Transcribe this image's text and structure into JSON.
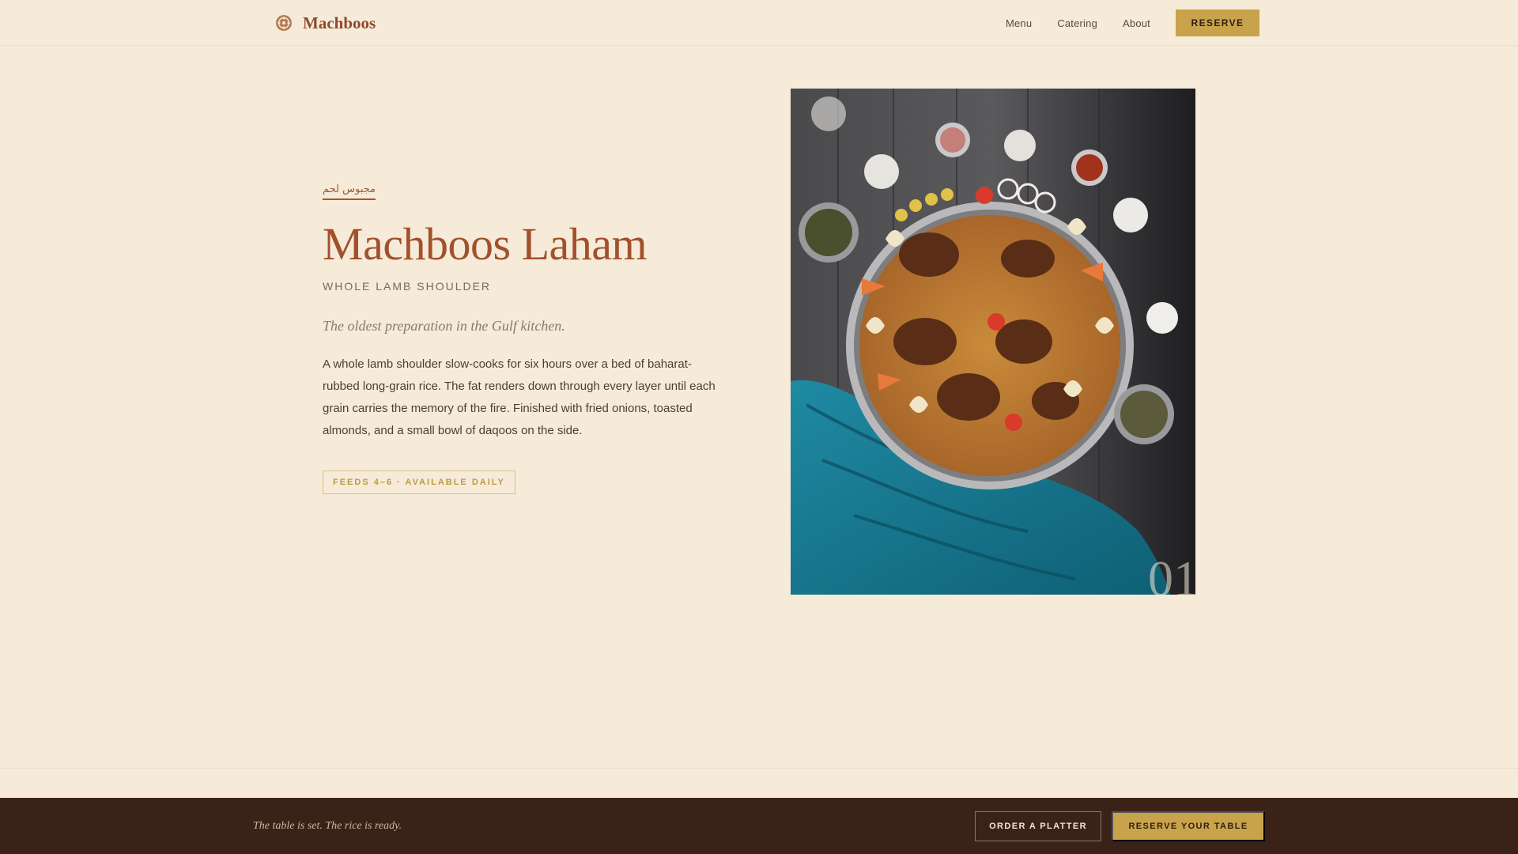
{
  "header": {
    "brand_name": "Machboos",
    "brand_logo_icon": "ornament-icon",
    "nav": [
      {
        "label": "Menu"
      },
      {
        "label": "Catering"
      },
      {
        "label": "About"
      }
    ],
    "reserve_label": "RESERVE"
  },
  "hero": {
    "arabic_name": "مجبوس لحم",
    "title": "Machboos Laham",
    "subtitle": "WHOLE LAMB SHOULDER",
    "tagline": "The oldest preparation in the Gulf kitchen.",
    "description": "A whole lamb shoulder slow-cooks for six hours over a bed of baharat-rubbed long-grain rice. The fat renders down through every layer until each grain carries the memory of the fire. Finished with fried onions, toasted almonds, and a small bowl of daqoos on the side.",
    "badge": "FEEDS 4–6 · AVAILABLE DAILY",
    "slide_number": "01"
  },
  "footer": {
    "text": "The table is set. The rice is ready.",
    "order_label": "ORDER A PLATTER",
    "reserve_label": "RESERVE YOUR TABLE"
  },
  "colors": {
    "background": "#f6ebd9",
    "accent_gold": "#c9a34b",
    "title_brown": "#a2512c",
    "footer_bg": "#3b2218"
  }
}
